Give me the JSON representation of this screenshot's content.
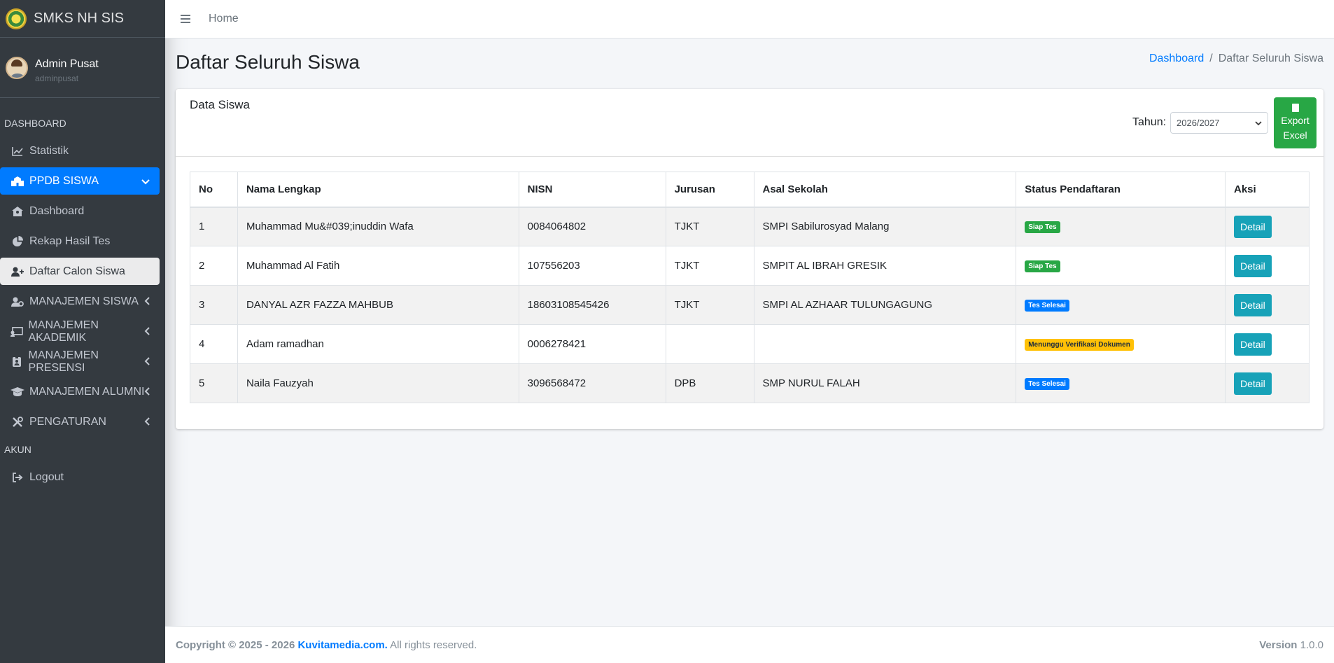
{
  "brand": {
    "name": "SMKS NH SIS"
  },
  "user": {
    "name": "Admin Pusat",
    "login": "adminpusat"
  },
  "sidebar": {
    "header_dashboard": "DASHBOARD",
    "header_akun": "AKUN",
    "items": [
      {
        "label": "Statistik",
        "icon": "chart-line-icon"
      },
      {
        "label": "PPDB SISWA",
        "icon": "school-icon"
      },
      {
        "label": "Dashboard",
        "icon": "home-icon"
      },
      {
        "label": "Rekap Hasil Tes",
        "icon": "pie-chart-icon"
      },
      {
        "label": "Daftar Calon Siswa",
        "icon": "user-plus-icon"
      },
      {
        "label": "MANAJEMEN SISWA",
        "icon": "users-cog-icon"
      },
      {
        "label": "MANAJEMEN AKADEMIK",
        "icon": "chalkboard-icon"
      },
      {
        "label": "MANAJEMEN PRESENSI",
        "icon": "id-badge-icon"
      },
      {
        "label": "MANAJEMEN ALUMNI",
        "icon": "graduation-cap-icon"
      },
      {
        "label": "PENGATURAN",
        "icon": "tools-icon"
      },
      {
        "label": "Logout",
        "icon": "sign-out-icon"
      }
    ]
  },
  "topbar": {
    "home": "Home"
  },
  "page": {
    "title": "Daftar Seluruh Siswa",
    "breadcrumb": {
      "home": "Dashboard",
      "sep": "/",
      "current": "Daftar Seluruh Siswa"
    }
  },
  "card": {
    "title": "Data Siswa",
    "tahun_label": "Tahun:",
    "tahun_value": "2026/2027",
    "export_line1": "Export",
    "export_line2": "Excel"
  },
  "table": {
    "headers": [
      "No",
      "Nama Lengkap",
      "NISN",
      "Jurusan",
      "Asal Sekolah",
      "Status Pendaftaran",
      "Aksi"
    ],
    "rows": [
      {
        "no": "1",
        "nama": "Muhammad Mu&#039;inuddin Wafa",
        "nisn": "0084064802",
        "jurusan": "TJKT",
        "asal": "SMPI Sabilurosyad Malang",
        "status": "Siap Tes",
        "action": "Detail"
      },
      {
        "no": "2",
        "nama": "Muhammad Al Fatih",
        "nisn": "107556203",
        "jurusan": "TJKT",
        "asal": "SMPIT AL IBRAH GRESIK",
        "status": "Siap Tes",
        "action": "Detail"
      },
      {
        "no": "3",
        "nama": "DANYAL AZR FAZZA MAHBUB",
        "nisn": "18603108545426",
        "jurusan": "TJKT",
        "asal": "SMPI AL AZHAAR TULUNGAGUNG",
        "status": "Tes Selesai",
        "action": "Detail"
      },
      {
        "no": "4",
        "nama": "Adam ramadhan",
        "nisn": "0006278421",
        "jurusan": "",
        "asal": "",
        "status": "Menunggu Verifikasi Dokumen",
        "action": "Detail"
      },
      {
        "no": "5",
        "nama": "Naila Fauzyah",
        "nisn": "3096568472",
        "jurusan": "DPB",
        "asal": "SMP NURUL FALAH",
        "status": "Tes Selesai",
        "action": "Detail"
      }
    ]
  },
  "footer": {
    "copyright": "Copyright © 2025 - 2026",
    "company": "Kuvitamedia.com.",
    "rights": "All rights reserved.",
    "version_label": "Version",
    "version_value": "1.0.0"
  }
}
